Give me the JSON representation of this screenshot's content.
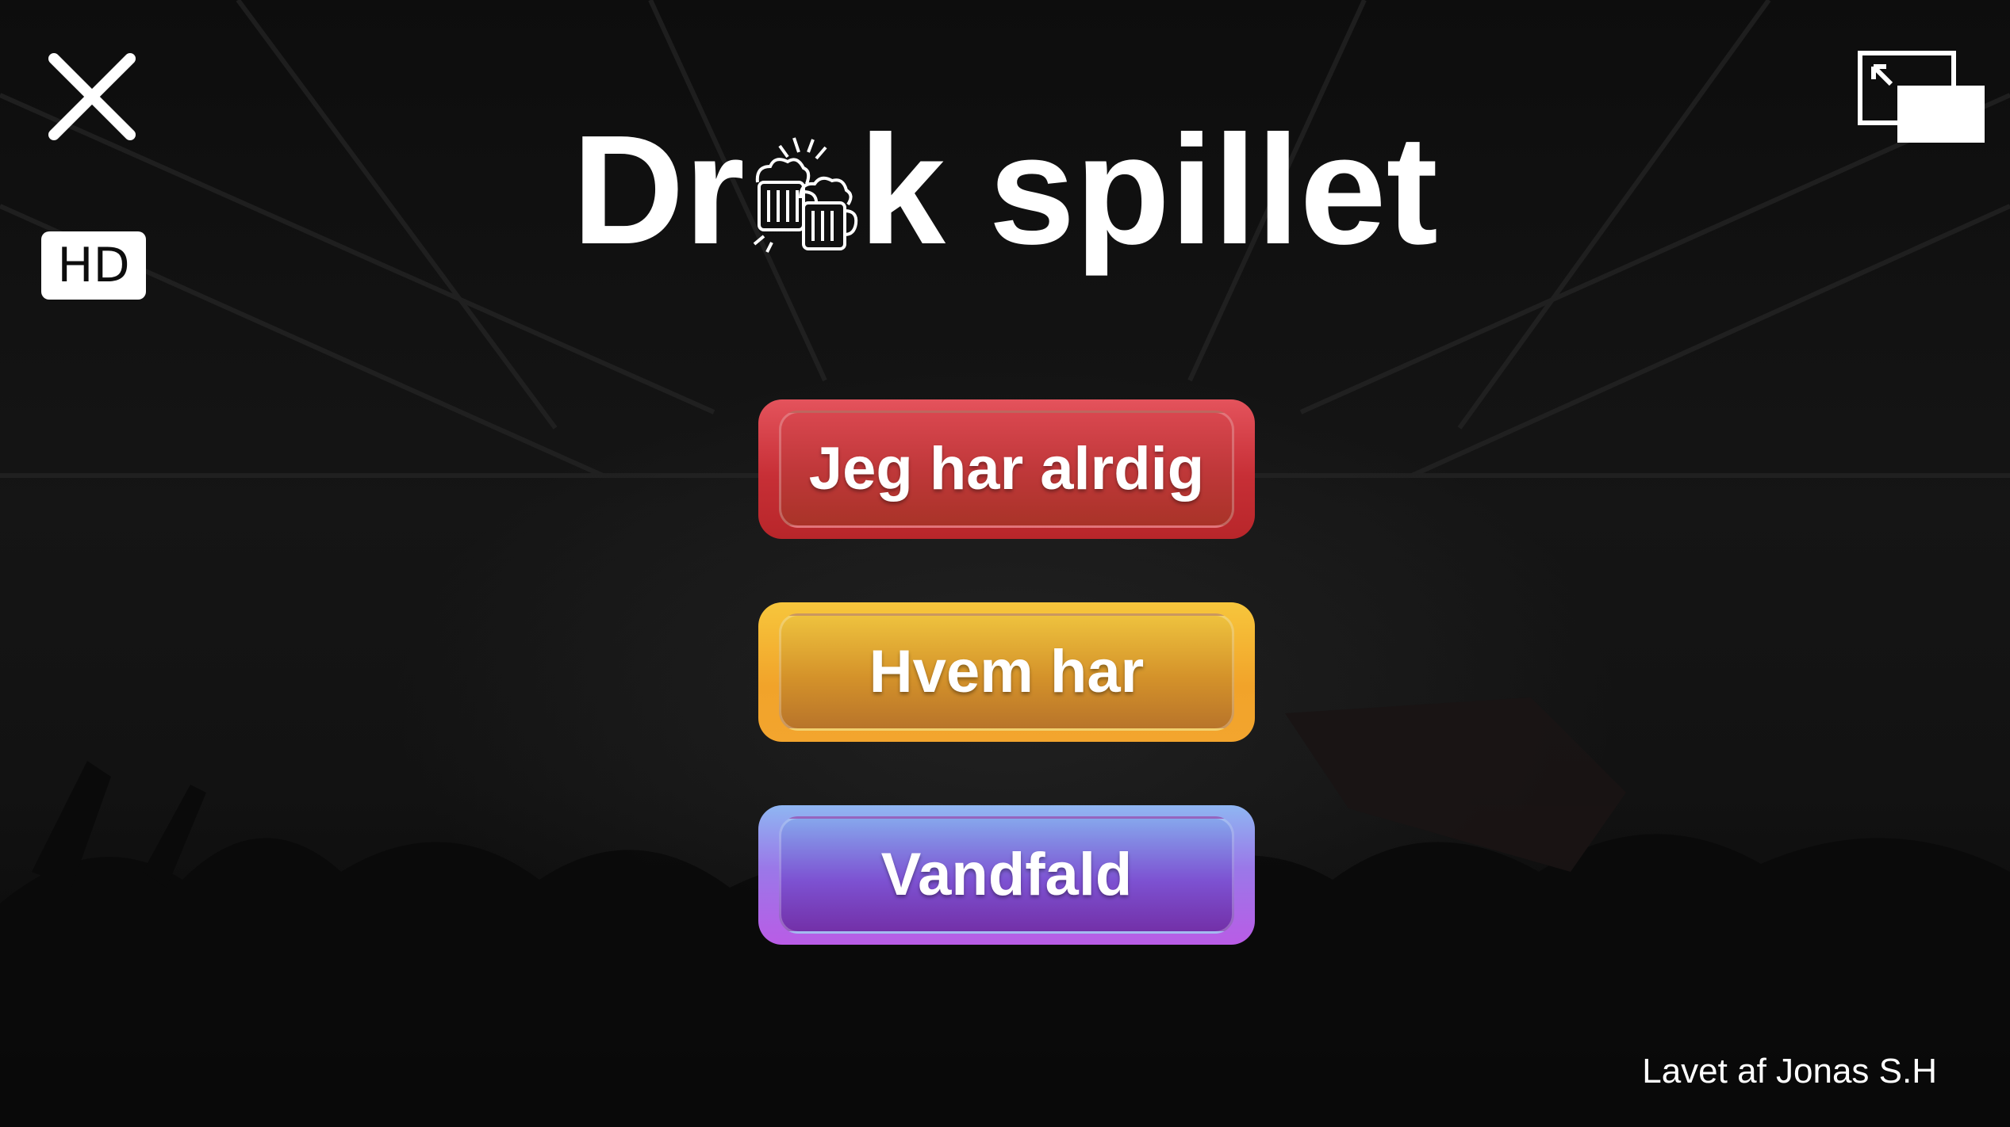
{
  "window": {
    "close_icon": "close-icon",
    "hd_label": "HD",
    "pip_icon": "picture-in-picture-exit-icon"
  },
  "title": {
    "before_icon": "Dr",
    "icon": "beer-mugs-cheers-icon",
    "after_icon": "k spillet"
  },
  "menu": {
    "buttons": [
      {
        "label": "Jeg har alrdig",
        "color": "#c7343a"
      },
      {
        "label": "Hvem har",
        "color": "#e39a2c"
      },
      {
        "label": "Vandfald",
        "color": "#8a58d8"
      }
    ]
  },
  "footer": {
    "credit": "Lavet af Jonas S.H"
  },
  "colors": {
    "background": "#111111",
    "text": "#ffffff"
  }
}
